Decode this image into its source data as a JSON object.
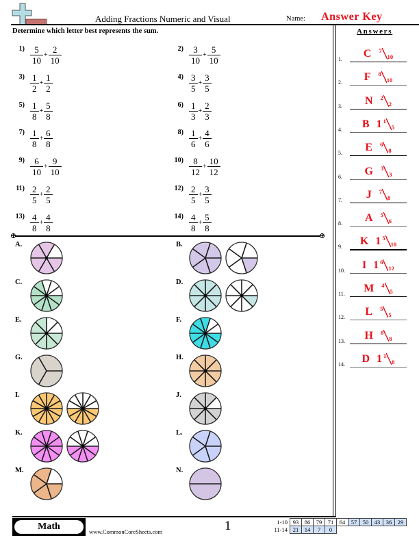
{
  "header": {
    "title": "Adding Fractions Numeric and Visual",
    "name_label": "Name:",
    "name_value": "Answer Key",
    "logo_icon": "plus-cross-logo"
  },
  "instructions": "Determine which letter best represents the sum.",
  "answers_heading": "Answers",
  "problems": [
    {
      "label": "1)",
      "a": {
        "n": "5",
        "d": "10"
      },
      "op": "+",
      "b": {
        "n": "2",
        "d": "10"
      }
    },
    {
      "label": "2)",
      "a": {
        "n": "3",
        "d": "10"
      },
      "op": "+",
      "b": {
        "n": "5",
        "d": "10"
      }
    },
    {
      "label": "3)",
      "a": {
        "n": "1",
        "d": "2"
      },
      "op": "+",
      "b": {
        "n": "1",
        "d": "2"
      }
    },
    {
      "label": "4)",
      "a": {
        "n": "3",
        "d": "5"
      },
      "op": "+",
      "b": {
        "n": "3",
        "d": "5"
      }
    },
    {
      "label": "5)",
      "a": {
        "n": "1",
        "d": "8"
      },
      "op": "+",
      "b": {
        "n": "5",
        "d": "8"
      }
    },
    {
      "label": "6)",
      "a": {
        "n": "1",
        "d": "3"
      },
      "op": "+",
      "b": {
        "n": "2",
        "d": "3"
      }
    },
    {
      "label": "7)",
      "a": {
        "n": "1",
        "d": "8"
      },
      "op": "+",
      "b": {
        "n": "6",
        "d": "8"
      }
    },
    {
      "label": "8)",
      "a": {
        "n": "1",
        "d": "6"
      },
      "op": "+",
      "b": {
        "n": "4",
        "d": "6"
      }
    },
    {
      "label": "9)",
      "a": {
        "n": "6",
        "d": "10"
      },
      "op": "+",
      "b": {
        "n": "9",
        "d": "10"
      }
    },
    {
      "label": "10)",
      "a": {
        "n": "8",
        "d": "12"
      },
      "op": "+",
      "b": {
        "n": "10",
        "d": "12"
      }
    },
    {
      "label": "11)",
      "a": {
        "n": "2",
        "d": "5"
      },
      "op": "+",
      "b": {
        "n": "2",
        "d": "5"
      }
    },
    {
      "label": "12)",
      "a": {
        "n": "2",
        "d": "5"
      },
      "op": "+",
      "b": {
        "n": "3",
        "d": "5"
      }
    },
    {
      "label": "13)",
      "a": {
        "n": "4",
        "d": "8"
      },
      "op": "+",
      "b": {
        "n": "4",
        "d": "8"
      }
    },
    {
      "label": "14)",
      "a": {
        "n": "4",
        "d": "8"
      },
      "op": "+",
      "b": {
        "n": "5",
        "d": "8"
      }
    }
  ],
  "choices": [
    {
      "label": "A.",
      "color": "#e6c6e6",
      "circles": [
        {
          "sectors": 6,
          "filled": 5
        }
      ]
    },
    {
      "label": "B.",
      "color": "#d4c8e8",
      "circles": [
        {
          "sectors": 5,
          "filled": 5
        },
        {
          "sectors": 5,
          "filled": 1
        }
      ]
    },
    {
      "label": "C.",
      "color": "#b4e2c8",
      "circles": [
        {
          "sectors": 10,
          "filled": 7
        }
      ]
    },
    {
      "label": "D.",
      "color": "#c6e6e6",
      "circles": [
        {
          "sectors": 8,
          "filled": 8
        },
        {
          "sectors": 8,
          "filled": 1
        }
      ]
    },
    {
      "label": "E.",
      "color": "#c6e8d4",
      "circles": [
        {
          "sectors": 8,
          "filled": 6
        }
      ]
    },
    {
      "label": "F.",
      "color": "#3ddde6",
      "circles": [
        {
          "sectors": 10,
          "filled": 8
        }
      ]
    },
    {
      "label": "G.",
      "color": "#d8d3cb",
      "circles": [
        {
          "sectors": 3,
          "filled": 3
        }
      ]
    },
    {
      "label": "H.",
      "color": "#f2cba3",
      "circles": [
        {
          "sectors": 8,
          "filled": 8
        }
      ]
    },
    {
      "label": "I.",
      "color": "#fbc774",
      "circles": [
        {
          "sectors": 12,
          "filled": 12
        },
        {
          "sectors": 12,
          "filled": 6
        }
      ]
    },
    {
      "label": "J.",
      "color": "#d3d3d3",
      "circles": [
        {
          "sectors": 8,
          "filled": 7
        }
      ]
    },
    {
      "label": "K.",
      "color": "#f38ef3",
      "circles": [
        {
          "sectors": 10,
          "filled": 10
        },
        {
          "sectors": 10,
          "filled": 5
        }
      ]
    },
    {
      "label": "L.",
      "color": "#c9d3f9",
      "circles": [
        {
          "sectors": 5,
          "filled": 5
        }
      ]
    },
    {
      "label": "M.",
      "color": "#ecb68a",
      "circles": [
        {
          "sectors": 5,
          "filled": 4
        }
      ]
    },
    {
      "label": "N.",
      "color": "#d3c5e3",
      "circles": [
        {
          "sectors": 2,
          "filled": 2
        }
      ]
    }
  ],
  "answers": [
    {
      "number": "1.",
      "letter": "C",
      "whole": "",
      "numerator": "7",
      "denominator": "10"
    },
    {
      "number": "2.",
      "letter": "F",
      "whole": "",
      "numerator": "8",
      "denominator": "10"
    },
    {
      "number": "3.",
      "letter": "N",
      "whole": "",
      "numerator": "2",
      "denominator": "2"
    },
    {
      "number": "4.",
      "letter": "B",
      "whole": "1",
      "numerator": "1",
      "denominator": "5"
    },
    {
      "number": "5.",
      "letter": "E",
      "whole": "",
      "numerator": "6",
      "denominator": "8"
    },
    {
      "number": "6.",
      "letter": "G",
      "whole": "",
      "numerator": "3",
      "denominator": "3"
    },
    {
      "number": "7.",
      "letter": "J",
      "whole": "",
      "numerator": "7",
      "denominator": "8"
    },
    {
      "number": "8.",
      "letter": "A",
      "whole": "",
      "numerator": "5",
      "denominator": "6"
    },
    {
      "number": "9.",
      "letter": "K",
      "whole": "1",
      "numerator": "5",
      "denominator": "10"
    },
    {
      "number": "10.",
      "letter": "I",
      "whole": "1",
      "numerator": "6",
      "denominator": "12"
    },
    {
      "number": "11.",
      "letter": "M",
      "whole": "",
      "numerator": "4",
      "denominator": "5"
    },
    {
      "number": "12.",
      "letter": "L",
      "whole": "",
      "numerator": "5",
      "denominator": "5"
    },
    {
      "number": "13.",
      "letter": "H",
      "whole": "",
      "numerator": "8",
      "denominator": "8"
    },
    {
      "number": "14.",
      "letter": "D",
      "whole": "1",
      "numerator": "1",
      "denominator": "8"
    }
  ],
  "footer": {
    "subject": "Math",
    "site": "www.CommonCoreSheets.com",
    "page": "1"
  },
  "score_table": [
    {
      "label": "1-10",
      "cells": [
        {
          "value": "93",
          "highlight": false
        },
        {
          "value": "86",
          "highlight": false
        },
        {
          "value": "79",
          "highlight": false
        },
        {
          "value": "71",
          "highlight": false
        },
        {
          "value": "64",
          "highlight": false
        },
        {
          "value": "57",
          "highlight": true
        },
        {
          "value": "50",
          "highlight": true
        },
        {
          "value": "43",
          "highlight": true
        },
        {
          "value": "36",
          "highlight": true
        },
        {
          "value": "29",
          "highlight": true
        }
      ]
    },
    {
      "label": "11-14",
      "cells": [
        {
          "value": "21",
          "highlight": true
        },
        {
          "value": "14",
          "highlight": true
        },
        {
          "value": "7",
          "highlight": true
        },
        {
          "value": "0",
          "highlight": true
        }
      ]
    }
  ],
  "colors": {
    "answer_red": "#e8101a",
    "score_highlight": "#cfe0f8"
  }
}
